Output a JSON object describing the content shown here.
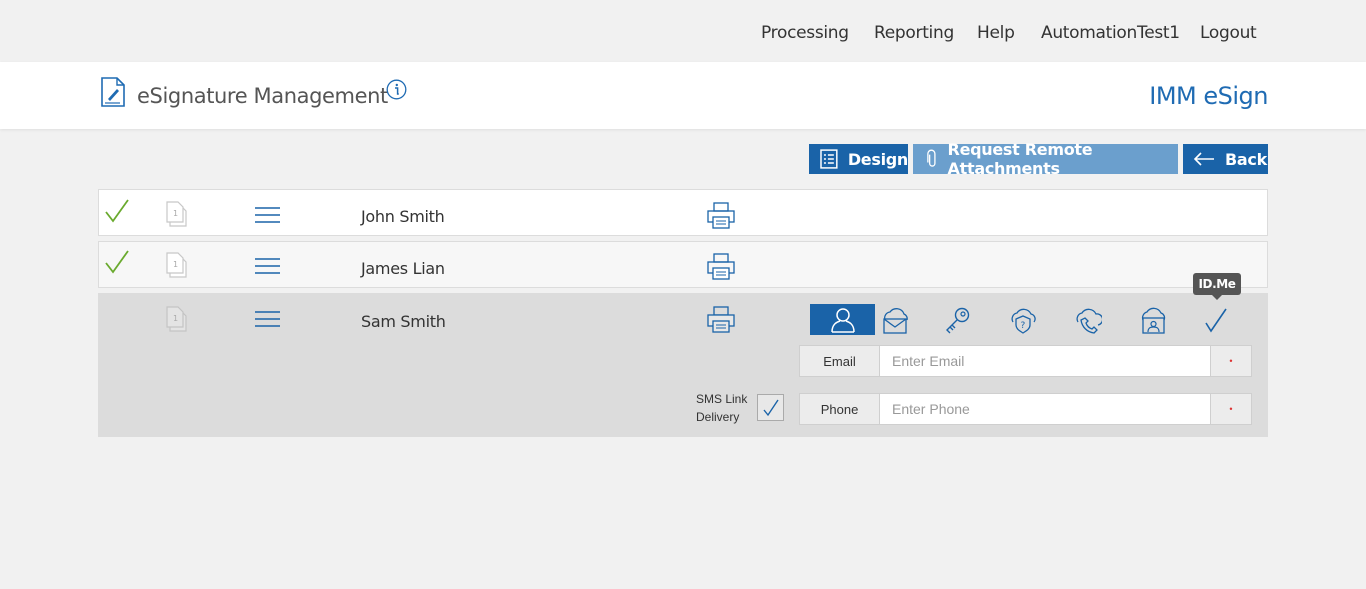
{
  "topnav": {
    "items": [
      {
        "label": "Processing"
      },
      {
        "label": "Reporting"
      },
      {
        "label": "Help"
      },
      {
        "label": "AutomationTest1"
      },
      {
        "label": "Logout"
      }
    ]
  },
  "header": {
    "title": "eSignature Management",
    "brand": "IMM eSign"
  },
  "toolbar": {
    "design_label": "Design",
    "remote_label": "Request Remote Attachments",
    "back_label": "Back"
  },
  "signers": [
    {
      "name": "John Smith",
      "doc_number": "1",
      "completed": true
    },
    {
      "name": "James Lian",
      "doc_number": "1",
      "completed": true
    },
    {
      "name": "Sam Smith",
      "doc_number": "1",
      "completed": false
    }
  ],
  "auth": {
    "icons": [
      "user-icon",
      "email-cloud-icon",
      "key-cloud-icon",
      "question-cloud-icon",
      "phone-cloud-icon",
      "id-cloud-icon",
      "idme-check-icon"
    ],
    "tooltip": "ID.Me",
    "email_label": "Email",
    "email_placeholder": "Enter Email",
    "phone_label": "Phone",
    "phone_placeholder": "Enter Phone",
    "required_marker": "•",
    "sms_line1": "SMS Link",
    "sms_line2": "Delivery",
    "sms_checked": true
  },
  "colors": {
    "primary": "#1a63a8",
    "primary_light": "#6b9fcd",
    "check_green": "#6aaa2e",
    "brand_blue": "#1f6bb3"
  }
}
